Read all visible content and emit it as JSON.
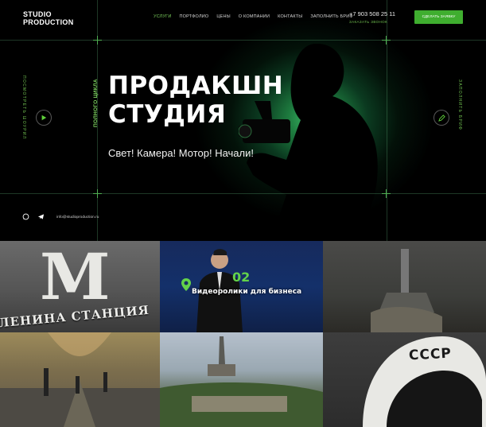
{
  "header": {
    "logo_line1": "STUDIO",
    "logo_line2": "PRODUCTION",
    "nav": [
      "Услуги",
      "Портфолио",
      "Цены",
      "О компании",
      "Контакты",
      "Заполнить бриф"
    ],
    "phone": "+7 903 508 25 11",
    "callback": "Заказать звонок",
    "cta_label": "Сделать заявку"
  },
  "hero": {
    "kicker": "Полного цикла",
    "title_line1": "ПРОДАКШН",
    "title_line2": "СТУДИЯ",
    "subtitle": "Свет! Камера! Мотор! Начали!",
    "left_side_label": "Посмотреть шоурил",
    "right_side_label": "Заполнить бриф",
    "email": "info@studioproduction.ru"
  },
  "tiles": {
    "t1_letter": "М",
    "t1_sign": "ЛЕНИНА СТАНЦИЯ",
    "t2_number": "02",
    "t2_label": "Видеоролики для бизнеса",
    "t6_text": "СССР"
  },
  "colors": {
    "accent": "#3fae2f",
    "accent_text": "#7cd25e",
    "background": "#000000"
  },
  "icons": {
    "play": "play-icon",
    "pen": "pen-icon",
    "whatsapp": "whatsapp-icon",
    "telegram": "telegram-icon"
  }
}
